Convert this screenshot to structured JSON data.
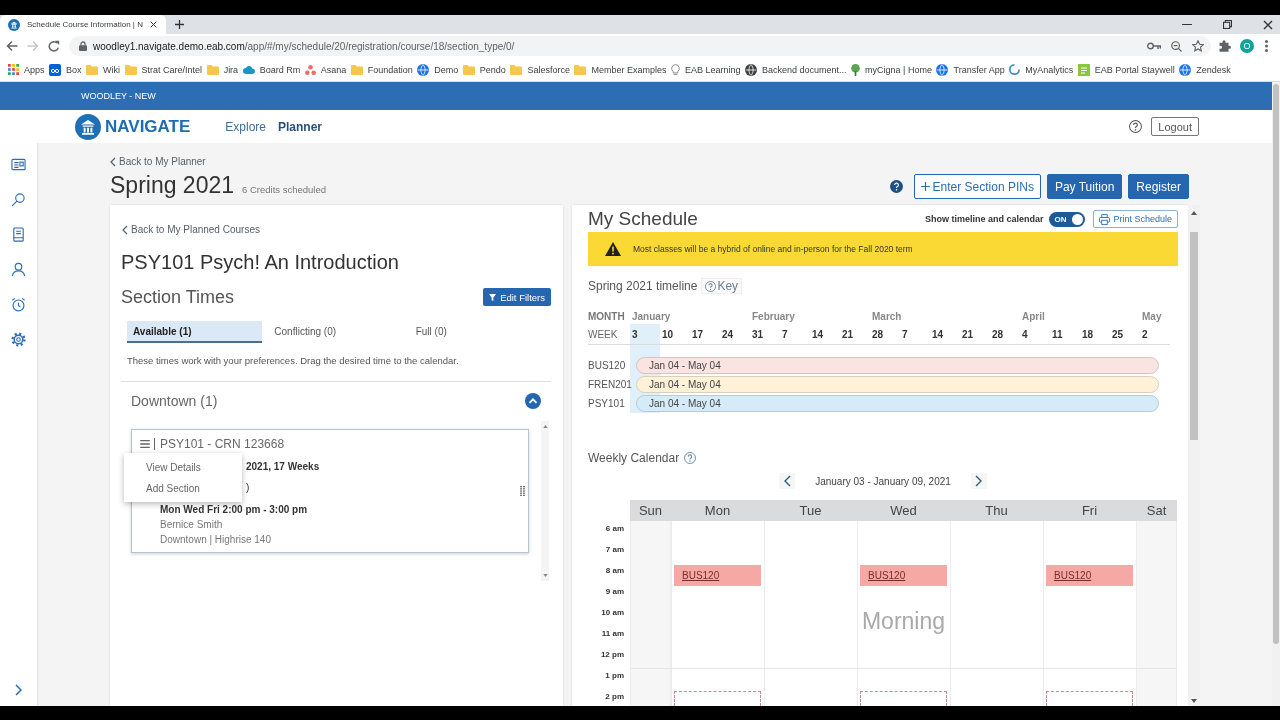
{
  "browser": {
    "tab_title": "Schedule Course Information | N",
    "url_host": "woodley1.navigate.demo.eab.com",
    "url_path": "/app/#/my/schedule/20/registration/course/18/section_type/0/",
    "profile_initial": "O",
    "bookmarks": [
      {
        "label": "Apps",
        "kind": "apps"
      },
      {
        "label": "Box",
        "kind": "box"
      },
      {
        "label": "Wiki",
        "kind": "folder"
      },
      {
        "label": "Strat Care/Intel",
        "kind": "folder"
      },
      {
        "label": "Jira",
        "kind": "folder"
      },
      {
        "label": "Board Rm",
        "kind": "cloud"
      },
      {
        "label": "Asana",
        "kind": "dots"
      },
      {
        "label": "Foundation",
        "kind": "folder"
      },
      {
        "label": "Demo",
        "kind": "globe"
      },
      {
        "label": "Pendo",
        "kind": "folder"
      },
      {
        "label": "Salesforce",
        "kind": "folder"
      },
      {
        "label": "Member Examples",
        "kind": "folder"
      },
      {
        "label": "EAB Learning",
        "kind": "bulb"
      },
      {
        "label": "Backend document...",
        "kind": "earth"
      },
      {
        "label": "myCigna | Home",
        "kind": "tree"
      },
      {
        "label": "Transfer App",
        "kind": "globe"
      },
      {
        "label": "MyAnalytics",
        "kind": "arc"
      },
      {
        "label": "EAB Portal Staywell",
        "kind": "tile"
      },
      {
        "label": "Zendesk",
        "kind": "globe"
      }
    ]
  },
  "app": {
    "environment": "WOODLEY - NEW",
    "logo": "NAVIGATE",
    "nav": [
      {
        "label": "Explore",
        "selected": false
      },
      {
        "label": "Planner",
        "selected": true
      }
    ],
    "logout": "Logout"
  },
  "sidebar": {
    "items": [
      {
        "kind": "card"
      },
      {
        "kind": "search"
      },
      {
        "kind": "book"
      },
      {
        "kind": "person"
      },
      {
        "kind": "alarm"
      },
      {
        "kind": "gear"
      }
    ],
    "expandable": true
  },
  "page": {
    "back_link": "Back to My Planner",
    "term": "Spring 2021",
    "credits": "6 Credits scheduled",
    "actions": [
      {
        "label": "Enter Section PINs",
        "kind": "add"
      },
      {
        "label": "Pay Tuition",
        "kind": "primary"
      },
      {
        "label": "Register",
        "kind": "primary"
      }
    ]
  },
  "course_panel": {
    "back_link": "Back to My Planned Courses",
    "title": "PSY101 Psych! An Introduction",
    "section_heading": "Section Times",
    "filter_button": "Edit Filters",
    "tabs": [
      {
        "label": "Available (1)",
        "selected": true
      },
      {
        "label": "Conflicting (0)",
        "selected": false
      },
      {
        "label": "Full (0)",
        "selected": false
      }
    ],
    "hint": "These times work with your preferences. Drag the desired time to the calendar.",
    "groups": [
      {
        "name": "Downtown (1)",
        "expanded": true,
        "sections": [
          {
            "title": "PSY101 - CRN 123668",
            "line_2": "2021, 17 Weeks",
            "line_3": ")",
            "times": "Mon Wed Fri 2:00 pm - 3:00 pm",
            "instructor": "Bernice Smith",
            "location": "Downtown | Highrise 140",
            "context_menu": [
              "View Details",
              "Add Section"
            ]
          }
        ]
      }
    ]
  },
  "schedule_panel": {
    "title": "My Schedule",
    "toggle": {
      "label": "Show timeline and calendar",
      "on": true,
      "state_text": "ON"
    },
    "print_button": "Print Schedule",
    "alert": "Most classes will be a hybrid of online and in-person for the Fall 2020 term",
    "timeline": {
      "title": "Spring 2021 timeline",
      "key_button": "Key",
      "month_label": "MONTH",
      "week_label": "WEEK",
      "weeks": [
        {
          "label": "3",
          "month": "January",
          "current": true
        },
        {
          "label": "10",
          "current": false
        },
        {
          "label": "17",
          "current": false
        },
        {
          "label": "24",
          "current": false
        },
        {
          "label": "31",
          "month": "February",
          "current": false
        },
        {
          "label": "7",
          "current": false
        },
        {
          "label": "14",
          "current": false
        },
        {
          "label": "21",
          "current": false
        },
        {
          "label": "28",
          "month": "March",
          "current": false
        },
        {
          "label": "7",
          "current": false
        },
        {
          "label": "14",
          "current": false
        },
        {
          "label": "21",
          "current": false
        },
        {
          "label": "28",
          "current": false
        },
        {
          "label": "4",
          "month": "April",
          "current": false
        },
        {
          "label": "11",
          "current": false
        },
        {
          "label": "18",
          "current": false
        },
        {
          "label": "25",
          "current": false
        },
        {
          "label": "2",
          "month": "May",
          "current": false
        }
      ],
      "courses": [
        {
          "name": "BUS120",
          "range": "Jan 04 - May 04",
          "color": "#fae4e2"
        },
        {
          "name": "FREN201",
          "range": "Jan 04 - May 04",
          "color": "#fdf1d8"
        },
        {
          "name": "PSY101",
          "range": "Jan 04 - May 04",
          "color": "#d5ebf8"
        }
      ]
    },
    "calendar": {
      "title": "Weekly Calendar",
      "range": "January 03 - January 09, 2021",
      "days": [
        {
          "label": "Sun",
          "weekend": true
        },
        {
          "label": "Mon",
          "weekend": false
        },
        {
          "label": "Tue",
          "weekend": false
        },
        {
          "label": "Wed",
          "weekend": false
        },
        {
          "label": "Thu",
          "weekend": false
        },
        {
          "label": "Fri",
          "weekend": false
        },
        {
          "label": "Sat",
          "weekend": true
        }
      ],
      "periods": [
        {
          "label": "Morning",
          "hours": [
            {
              "label": "6 am"
            },
            {
              "label": "7 am"
            },
            {
              "label": "8 am",
              "cells": [
                {
                  "kind": "empty"
                },
                {
                  "kind": "class",
                  "label": "BUS120",
                  "color": "#f5a8a4"
                },
                {
                  "kind": "empty"
                },
                {
                  "kind": "class",
                  "label": "BUS120",
                  "color": "#f5a8a4"
                },
                {
                  "kind": "empty"
                },
                {
                  "kind": "class",
                  "label": "BUS120",
                  "color": "#f5a8a4"
                },
                {
                  "kind": "empty"
                }
              ]
            },
            {
              "label": "9 am"
            },
            {
              "label": "10 am"
            },
            {
              "label": "11 am"
            },
            {
              "label": "12 pm"
            }
          ]
        },
        {
          "hours": [
            {
              "label": "1 pm"
            },
            {
              "label": "2 pm",
              "cells": [
                {
                  "kind": "empty"
                },
                {
                  "kind": "drop_target"
                },
                {
                  "kind": "empty"
                },
                {
                  "kind": "drop_target"
                },
                {
                  "kind": "empty"
                },
                {
                  "kind": "drop_target"
                },
                {
                  "kind": "empty"
                }
              ]
            }
          ]
        }
      ]
    }
  }
}
